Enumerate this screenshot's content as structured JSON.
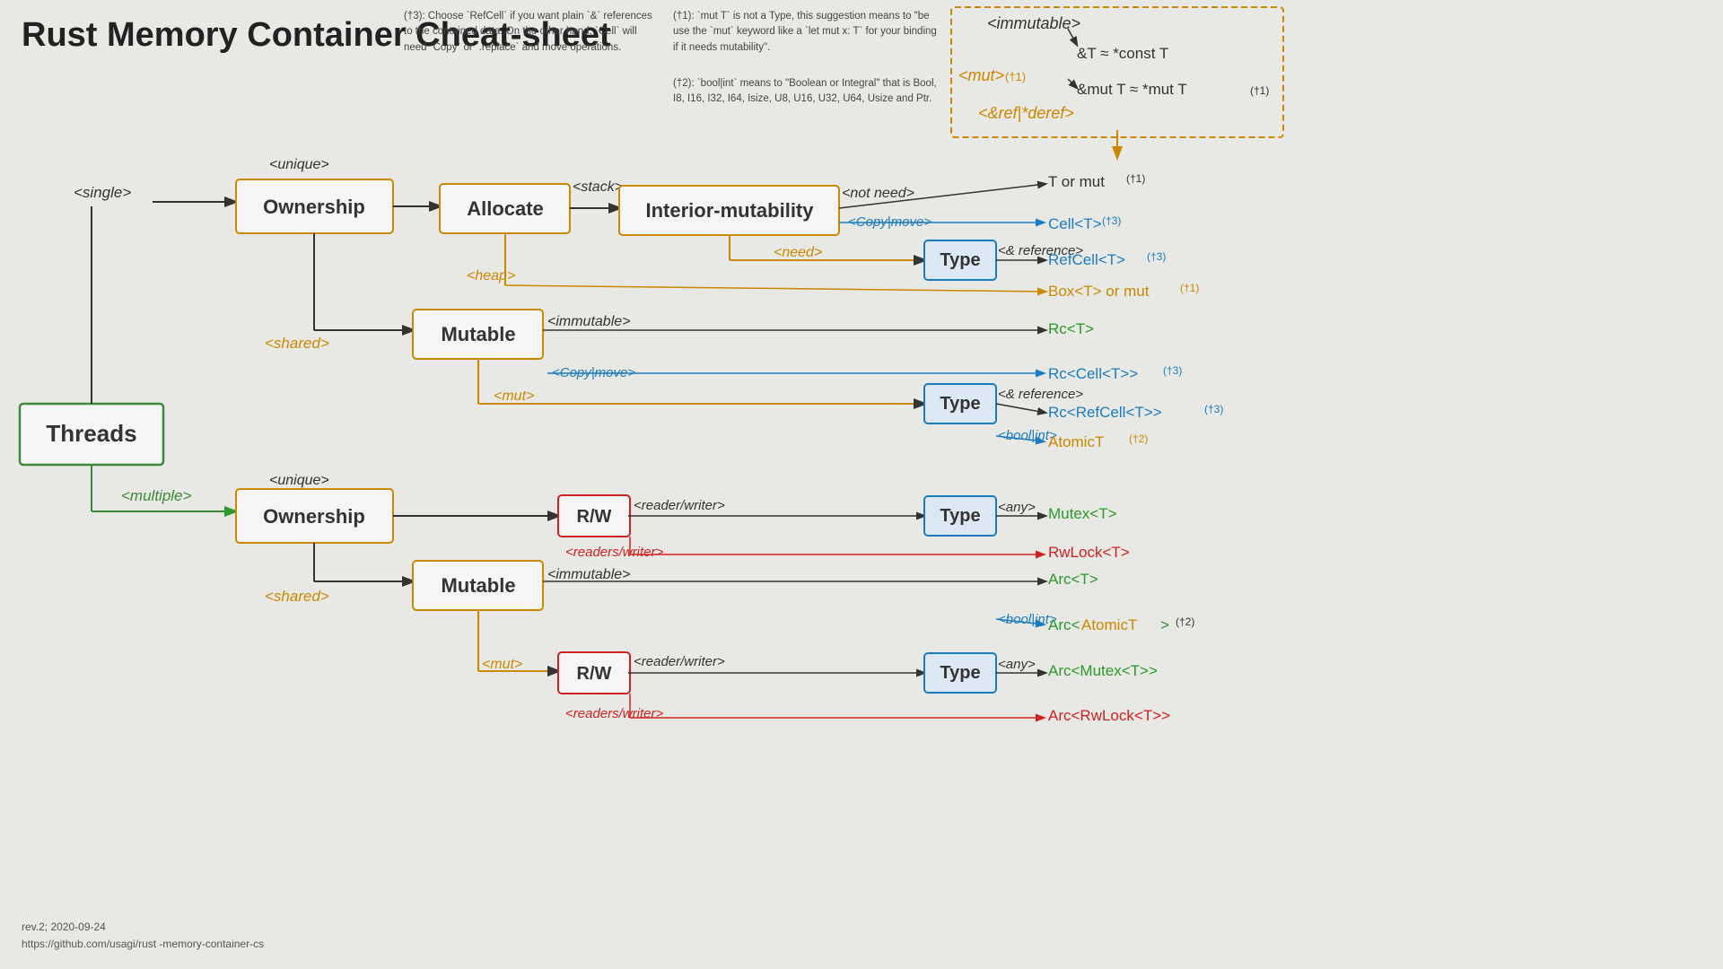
{
  "title": "Rust Memory Container Cheat-sheet",
  "note1": "(†3): Choose `RefCell` if you want plain `&` references to the contained data. On the other hand, `Cell` will need `Copy` or `.replace` and move operations.",
  "note2": "(†1): `mut T` is not a Type, this suggestion means to \"be use the `mut` keyword like a `let mut x: T` for your binding if it needs mutability\".",
  "note3": "(†2): `bool|int` means to \"Boolean or Integral\" that is Bool, I8, I16, I32, I64, Isize, U8, U16, U32, U64, Usize and Ptr.",
  "footer_line1": "rev.2; 2020-09-24",
  "footer_line2": "https://github.com/usagi/rust -memory-container-cs"
}
